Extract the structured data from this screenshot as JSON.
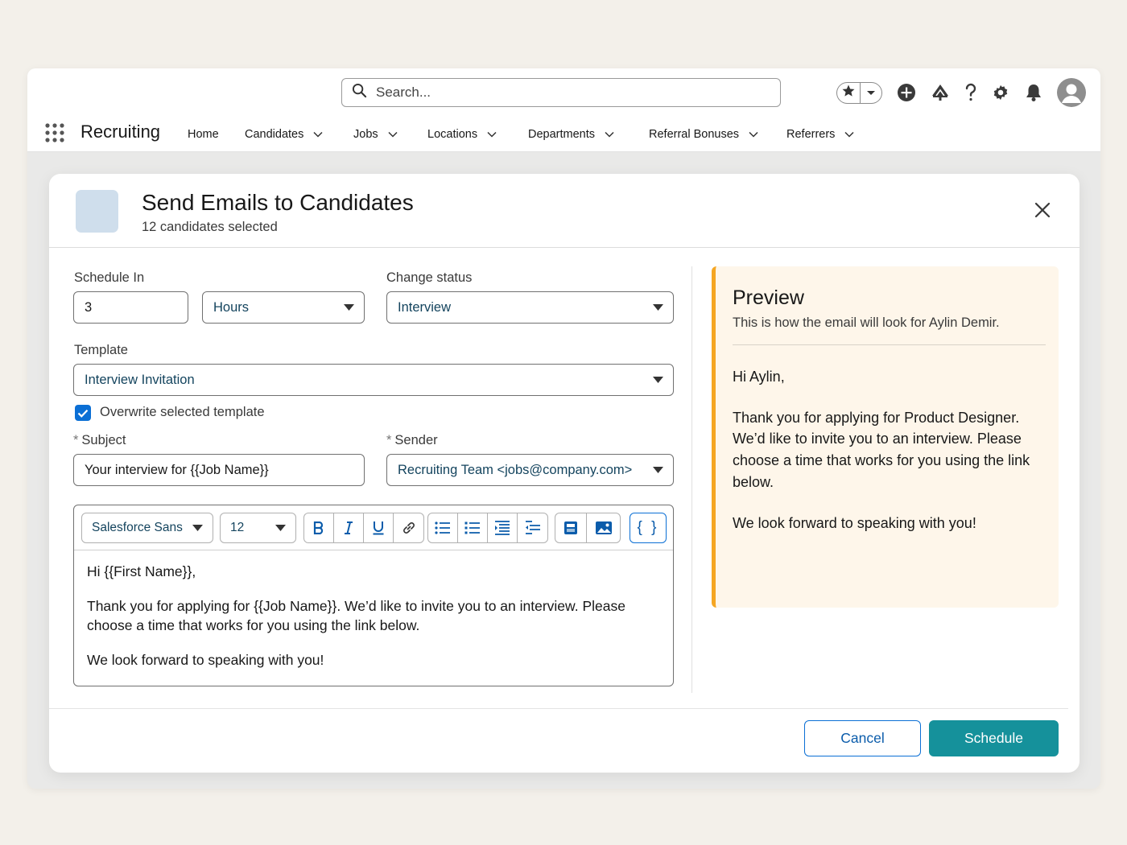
{
  "header": {
    "search_placeholder": "Search...",
    "icons": [
      "search-icon",
      "star-icon",
      "chevron-down-icon",
      "add-icon",
      "trailhead-icon",
      "help-icon",
      "gear-icon",
      "bell-icon",
      "avatar-icon"
    ]
  },
  "nav": {
    "app_name": "Recruiting",
    "items": [
      {
        "label": "Home"
      },
      {
        "label": "Candidates"
      },
      {
        "label": "Jobs"
      },
      {
        "label": "Locations"
      },
      {
        "label": "Departments"
      },
      {
        "label": "Referral Bonuses"
      },
      {
        "label": "Referrers"
      }
    ]
  },
  "modal": {
    "title": "Send Emails to Candidates",
    "subtitle": "12 candidates selected",
    "form": {
      "schedule_label": "Schedule In",
      "schedule_value": "3",
      "schedule_unit": "Hours",
      "status_label": "Change status",
      "status_value": "Interview",
      "template_label": "Template",
      "template_value": "Interview Invitation",
      "overwrite_label": "Overwrite selected template",
      "overwrite_checked": true,
      "required_mark": "*",
      "subject_label": "Subject",
      "subject_value": "Your interview for {{Job Name}}",
      "sender_label": "Sender",
      "sender_value": "Recruiting Team <jobs@company.com>"
    },
    "editor": {
      "font": "Salesforce Sans",
      "size": "12",
      "merge_label": "{ }",
      "body": [
        "Hi {{First Name}},",
        "Thank you for applying for {{Job Name}}. We’d like to invite you to an interview. Please choose a time that works for you using the link below.",
        "We look forward to speaking with you!"
      ]
    },
    "preview": {
      "title": "Preview",
      "subtitle": "This is how the email will look for Aylin Demir.",
      "body": [
        "Hi Aylin,",
        "Thank you for applying for Product Designer. We’d like to invite you to an interview. Please choose a time that works for you using the link below.",
        "We look forward to speaking with you!"
      ]
    },
    "buttons": {
      "cancel": "Cancel",
      "schedule": "Schedule"
    }
  },
  "colors": {
    "accent_blue": "#0b6fd5",
    "schedule_teal": "#15919b",
    "preview_bg": "#fef6ea",
    "preview_border": "#f5a623",
    "select_text": "#14445e"
  }
}
